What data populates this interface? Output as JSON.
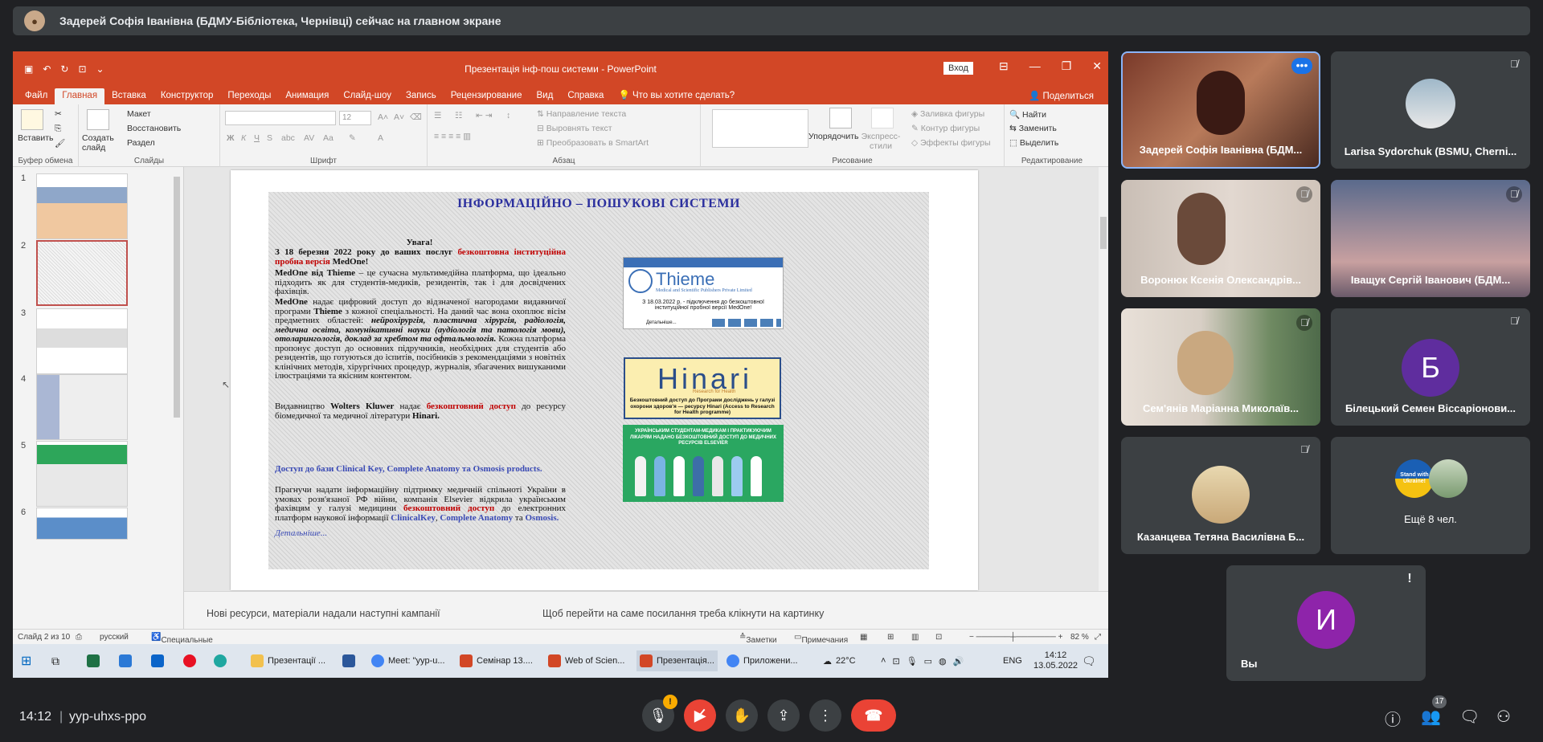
{
  "banner": {
    "presenter_text": "Задерей Софія Іванівна (БДМУ-Бібліотека, Чернівці) сейчас на главном экране"
  },
  "powerpoint": {
    "window_title": "Презентація інф-пош системи  -  PowerPoint",
    "login_button": "Вход",
    "tabs": [
      "Файл",
      "Главная",
      "Вставка",
      "Конструктор",
      "Переходы",
      "Анимация",
      "Слайд-шоу",
      "Запись",
      "Рецензирование",
      "Вид",
      "Справка"
    ],
    "active_tab": "Главная",
    "tell_me": "Что вы хотите сделать?",
    "share": "Поделиться",
    "ribbon": {
      "paste": "Вставить",
      "clipboard_label": "Буфер обмена",
      "new_slide": "Создать слайд",
      "layout": "Макет",
      "reset": "Восстановить",
      "section": "Раздел",
      "slides_label": "Слайды",
      "font_label": "Шрифт",
      "font_size": "12",
      "text_direction": "Направление текста",
      "align_text": "Выровнять текст",
      "smartart": "Преобразовать в SmartArt",
      "paragraph_label": "Абзац",
      "arrange": "Упорядочить",
      "quick_styles": "Экспресс-стили",
      "shape_fill": "Заливка фигуры",
      "shape_outline": "Контур фигуры",
      "shape_effects": "Эффекты фигуры",
      "drawing_label": "Рисование",
      "find": "Найти",
      "replace": "Заменить",
      "select": "Выделить",
      "editing_label": "Редактирование"
    },
    "thumbnails": [
      "1",
      "2",
      "3",
      "4",
      "5",
      "6"
    ],
    "slide": {
      "heading": "ІНФОРМАЦІЙНО – ПОШУКОВІ СИСТЕМИ",
      "attention": "Увага!",
      "p1_a": "З 18 березня 2022 року до ваших послуг",
      "p1_red": "безкоштовна інституційна пробна версія",
      "p1_b": "MedOne!",
      "p2_bold": "MedOne від Thieme",
      "p2": "– це сучасна мультимедійна платформа, що ідеально підходить як для студентів-медиків, резидентів, так і для досвідчених фахівців.",
      "p3_bold": "MedOne",
      "p3_a": "надає цифровий доступ до відзначеної нагородами видавничої програми",
      "p3_bold2": "Thieme",
      "p3_b": "з кожної спеціальності. На даний час вона охоплює вісім предметних областей:",
      "p3_italic": "нейрохірургія, пластична хірургія, радіологія, медична освіта, комунікативні науки (аудіологія та патологія мови), отоларингологія, доклад за хребтом та офтальмологія.",
      "p3_c": "Кожна платформа пропонує доступ до основних підручників, необхідних для студентів або резидентів, що готуються до іспитів, посібників з рекомендаціями з новітніх клінічних методів, хірургічних процедур, журналів, збагачених вишуканими ілюстраціями та якісним контентом.",
      "p4_a": "Видавництво",
      "p4_bold": "Wolters Kluwer",
      "p4_b": "надає",
      "p4_red": "безкоштовний доступ",
      "p4_c": "до ресурсу біомедичної та медичної літератури",
      "p4_bold2": "Hinari.",
      "p5_blue": "Доступ до бази Clinical Key, Complete Anatomy та Osmosis products.",
      "p6_a": "Прагнучи надати інформаційну підтримку медичній спільноті України в умовах розв'язаної РФ війни, компанія Elsevier відкрила українським фахівцям у галузі медицини",
      "p6_red": "безкоштовний доступ",
      "p6_b": "до електронних платформ наукової інформації",
      "p6_blue1": "ClinicalKey",
      "p6_c": ",",
      "p6_blue2": "Complete Anatomy",
      "p6_d": "та",
      "p6_blue3": "Osmosis.",
      "more_link": "Детальніше...",
      "thieme": {
        "logo": "Thieme",
        "sub": "Medical and Scientific Publishers Private Limited",
        "caption": "З 18.03.2022 р. - підключення до безкоштовної інституційної пробної версії MedOne!",
        "more": "Детальніше..."
      },
      "hinari": {
        "logo": "Hinari",
        "tag": "Research for Health",
        "caption": "Безкоштовний доступ до Програми досліджень у галузі охорони здоров'я — ресурсу Hinari (Access to Research for Health programme)"
      },
      "elsevier": {
        "caption": "УКРАЇНСЬКИМ СТУДЕНТАМ-МЕДИКАМ І ПРАКТИКУЮЧИМ ЛІКАРЯМ НАДАНО БЕЗКОШТОВНИЙ ДОСТУП ДО МЕДИЧНИХ РЕСУРСІВ ELSEVIER"
      }
    },
    "notes_left": "Нові ресурси, матеріали надали наступні  кампанії",
    "notes_right": "Щоб перейти на саме  посилання треба клікнути на картинку",
    "status": {
      "slide": "Слайд 2 из 10",
      "lang": "русский",
      "access": "Специальные возможности: проверьте рекомендации",
      "notes": "Заметки",
      "comments": "Примечания",
      "zoom": "82 %"
    }
  },
  "taskbar": {
    "items": [
      "Презентації ...",
      "Meet: \"yyp-u...",
      "Семінар 13....",
      "Web of Scien...",
      "Презентація...",
      "Приложени..."
    ],
    "temp": "22°C",
    "lang": "ENG",
    "time": "14:12",
    "date": "13.05.2022"
  },
  "participants": [
    {
      "name": "Задерей Софія Іванівна (БДМ..."
    },
    {
      "name": "Larisa Sydorchuk (BSMU, Cherni..."
    },
    {
      "name": "Воронюк Ксенія Олександрів..."
    },
    {
      "name": "Іващук Сергій Іванович (БДМ..."
    },
    {
      "name": "Сем'янів Маріанна Миколаїв..."
    },
    {
      "name": "Білецький Семен Віссаріонови...",
      "initial": "Б"
    },
    {
      "name": "Казанцева Тетяна Василівна Б..."
    },
    {
      "name": "Ещё 8 чел.",
      "badge": "Stand with Ukraine!"
    },
    {
      "name": "Вы",
      "initial": "И"
    }
  ],
  "meet": {
    "time": "14:12",
    "code": "yyp-uhxs-ppo",
    "people_count": "17",
    "warn": "!"
  },
  "colors": {
    "pp_accent": "#d24726",
    "meet_bg": "#202124",
    "tile_bg": "#3c4043",
    "end_call": "#ea4335"
  }
}
